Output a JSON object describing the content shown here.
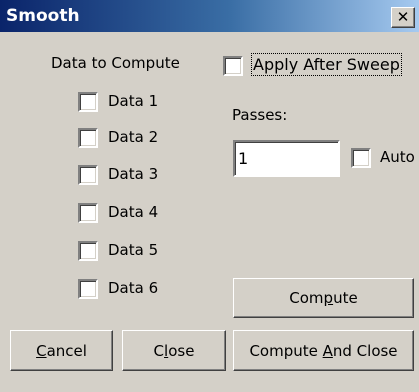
{
  "window": {
    "title": "Smooth",
    "close_glyph": "✕"
  },
  "data_group": {
    "heading": "Data to Compute",
    "items": [
      {
        "label": "Data 1",
        "checked": false
      },
      {
        "label": "Data 2",
        "checked": false
      },
      {
        "label": "Data 3",
        "checked": false
      },
      {
        "label": "Data 4",
        "checked": false
      },
      {
        "label": "Data 5",
        "checked": false
      },
      {
        "label": "Data 6",
        "checked": false
      }
    ]
  },
  "apply_after_sweep": {
    "label": "Apply After Sweep",
    "checked": false
  },
  "passes": {
    "label": "Passes:",
    "value": "1"
  },
  "auto": {
    "label": "Auto",
    "checked": false
  },
  "buttons": {
    "compute": {
      "pre": "Com",
      "key": "p",
      "post": "ute"
    },
    "cancel": {
      "pre": "",
      "key": "C",
      "post": "ancel"
    },
    "close": {
      "pre": "C",
      "key": "l",
      "post": "ose"
    },
    "compute_and_close": {
      "pre": "Compute ",
      "key": "A",
      "post": "nd Close"
    }
  }
}
